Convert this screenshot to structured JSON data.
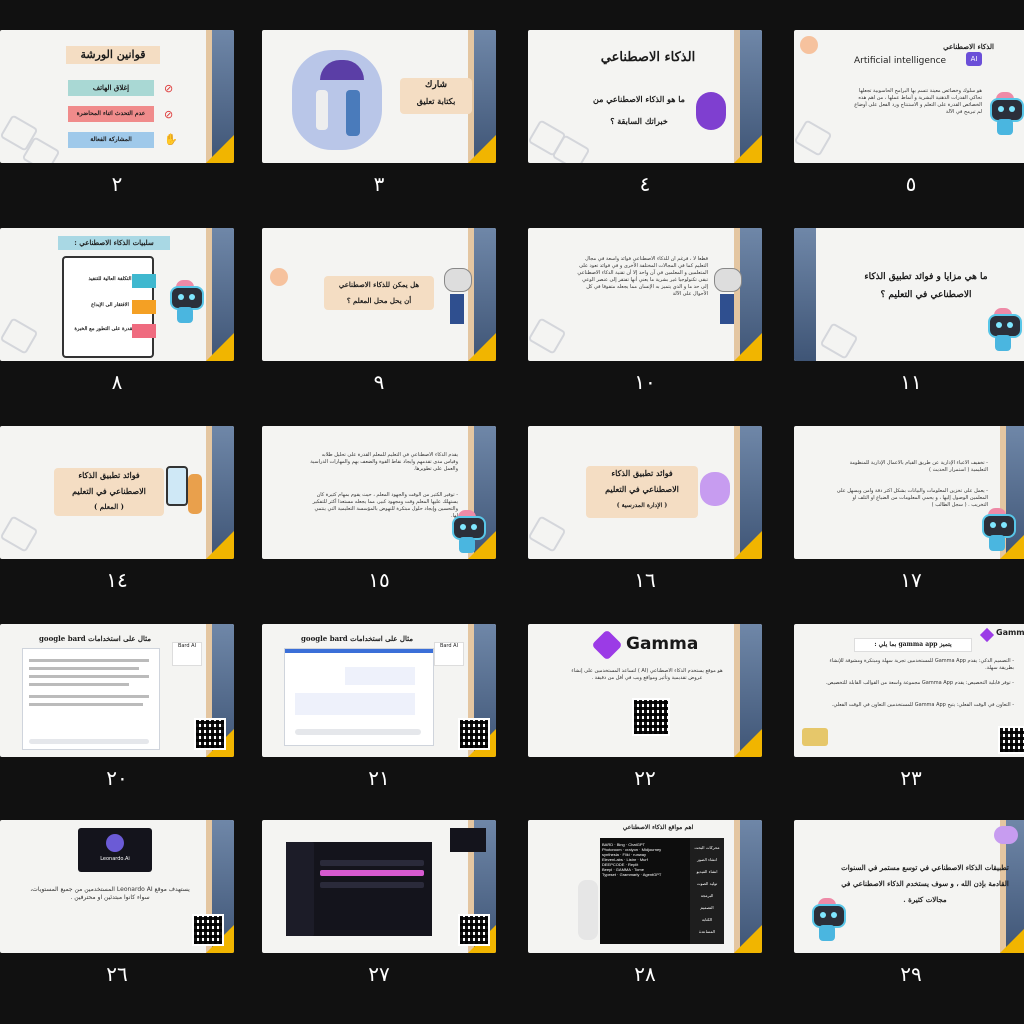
{
  "slides": [
    {
      "number": "٢",
      "title": "قوانين الورشة",
      "rules": [
        "إغلاق الهاتف",
        "عدم التحدث اثناء المحاضرة",
        "المشاركة الفعالة"
      ]
    },
    {
      "number": "٣",
      "title": "شارك",
      "subtitle": "بكتابة تعليق"
    },
    {
      "number": "٤",
      "title": "الذكاء الاصطناعي",
      "question": "ما هو الذكاء الاصطناعي من",
      "question2": "خبراتك السابقة ؟"
    },
    {
      "number": "٥",
      "title": "الذكاء الاصطناعي",
      "subtitle": "Artificial intelligence",
      "icon": "AI",
      "body": "هو سلوك وخصائص معينة تتسم بها البرامج الحاسوبية تجعلها تحاكي القدرات الذهنية البشرية و أنماط عملها ، من اهم هذه الخصائص القدرة على التعلم و الاستنتاج ورد الفعل على أوضاع لم تبرمج في الآلة"
    },
    {
      "number": "٨",
      "title": "سلبيات الذكاء الاصطناعي :",
      "items": [
        "التكلفة العالية للتنفيذ",
        "الافتقار الى الإبداع",
        "عدم القدرة على التطور مع الخبرة"
      ]
    },
    {
      "number": "٩",
      "title": "هل يمكن للذكاء الاصطناعي",
      "title2": "أن يحل محل المعلم ؟"
    },
    {
      "number": "١٠",
      "body": "قطعا لا ، فرغم أن للذكاء الاصطناعي فوائد واسعة في مجال التعليم كما في المجالات المختلفة الأخرى و في فوائد تعود على المتعلمين و المعلمين في آن واحد إلا أن تقنية الذكاء الاصطناعي تبقى تكنولوجيا غير بشرية ما يعني أنها تفتقر إلى عنصر الوعي إلى حد ما و الذي يتميز به الإنسان مما يجعله متفوقا في كل الأحوال على الآلة"
    },
    {
      "number": "١١",
      "title": "ما هي مزايا و فوائد تطبيق الذكاء",
      "title2": "الاصطناعي في التعليم ؟"
    },
    {
      "number": "١٤",
      "title": "فوائد تطبيق الذكاء",
      "title2": "الاصطناعي في التعليم",
      "title3": "( المعلم )"
    },
    {
      "number": "١٥",
      "body": "يقدم الذكاء الاصطناعي في التعليم للمعلم القدرة على تحليل طلابه وقياس مدى تقدمهم وايجاد نقاط القوة والضعف بهم والمهارات الدراسية والعمل على تطويرها.",
      "body2": "- توفير الكثير من الوقت والجهود المعلم ، حيث يقوم بمهام كثيرة كان يستهلك عليها المعلم وقت ومجهود كبير، مما يجعله مستعدا أكثر للتفكير والتحسين وإيجاد حلول مبتكرة للنهوض بالمؤسسة التعليمية التي ينتمي لها."
    },
    {
      "number": "١٦",
      "title": "فوائد تطبيق الذكاء",
      "title2": "الاصطناعي في التعليم",
      "title3": "( الإدارة المدرسية )"
    },
    {
      "number": "١٧",
      "body": "- تخفيف الأعباء الإدارية عن طريق القيام بالأعمال الإدارية للمنظومة التعليمية ( استمرار الحديث )",
      "body2": "- يعمل على تخزين المعلومات والبيانات بشكل أكثر دقة وأمن ويسهل على المعلمين الوصول إليها ، و يحمي المعلومات من الضياع او التلف او التخريب . ( سجل الطالب )"
    },
    {
      "number": "٢٠",
      "title": "مثال على استخدامات google bard",
      "badge": "Bard AI"
    },
    {
      "number": "٢١",
      "title": "مثال على استخدامات google bard",
      "badge": "Bard AI"
    },
    {
      "number": "٢٢",
      "brand": "Gamma",
      "body": "هو موقع يستخدم الذكاء الاصطناعي (AI ) لتساعد المستخدمين على إنشاء عروض تقديمية وتأثير ومواقع ويب في أقل من دقيقة ."
    },
    {
      "number": "٢٣",
      "brand": "Gamma",
      "title": "يتميز gamma app بما يلي :",
      "body": "- التصميم الذكي: يقدم Gamma App للمستخدمين تجربة سهلة ومبتكرة ومشوقة للإنشاء بطريقة سهلة.",
      "body2": "- توفر قابلية التخصيص: يقدم Gamma App مجموعة واسعة من القوالب القابلة للتخصيص.",
      "body3": "- التعاون في الوقت الفعلي: يتيح Gamma App للمستخدمين التعاون في الوقت الفعلي."
    },
    {
      "number": "٢٦",
      "brand": "Leonardo.Ai",
      "body": "يستهدف موقع Leonardo AI المستخدمين من جميع المستويات، سواء كانوا مبتدئين او محترفين ."
    },
    {
      "number": "٢٧"
    },
    {
      "number": "٢٨",
      "title": "اهم مواقع الذكاء الاصطناعي",
      "tools": [
        "BARD",
        "Bing",
        "ChatGPT",
        "Photoroom",
        "craiyon",
        "Midjourney",
        "synthesia",
        "Fliki",
        "runway",
        "ElevenLabs",
        "Listnr",
        "Murf",
        "DEEPCODE",
        "Replit",
        "Beepl",
        "GAMMA",
        "Tome",
        "Typeset",
        "Grammarly",
        "AgentGPT"
      ],
      "categories": [
        "محركات البحث",
        "انشاء الصور",
        "انشاء الفيديو",
        "توليد الصوت",
        "البرمجة",
        "التصميم",
        "الكتابة",
        "المساعدة"
      ]
    },
    {
      "number": "٢٩",
      "body": "تطبيقات الذكاء الاصطناعي في توسع مستمر في السنوات القادمة بإذن الله ، و سوف يستخدم الذكاء الاصطناعي في مجالات كثيرة ."
    }
  ],
  "colors": {
    "background": "#111111",
    "slide": "#f4f4f2",
    "accent": "#f1b500",
    "frame": "#4d6688"
  }
}
